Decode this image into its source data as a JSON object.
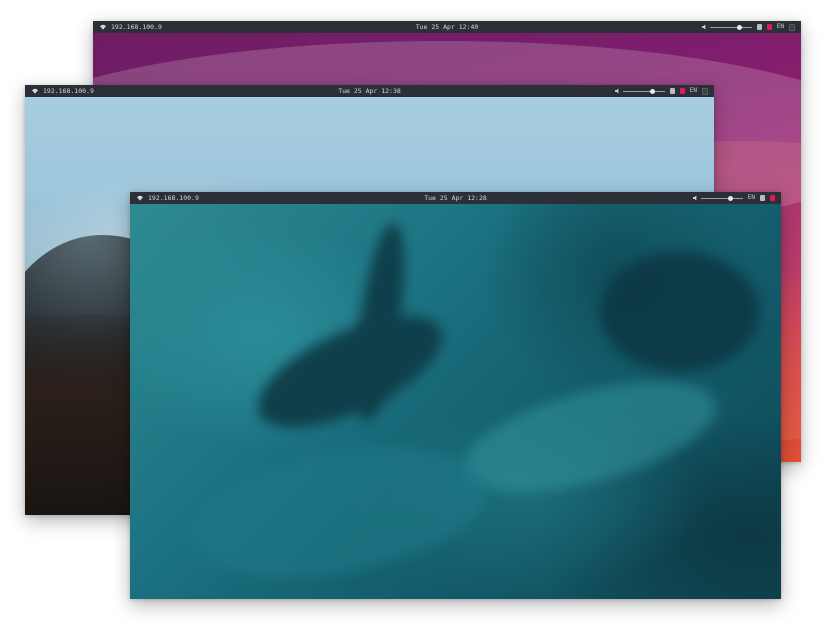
{
  "screens": {
    "back": {
      "ip": "192.168.100.9",
      "datetime": "Tue 25 Apr 12:40",
      "lang": "EN"
    },
    "mid": {
      "ip": "192.168.100.9",
      "datetime": "Tue 25 Apr 12:38",
      "lang": "EN"
    },
    "front": {
      "ip": "192.168.100.9",
      "datetime": "Tue 25 Apr 12:28",
      "lang": "EN"
    }
  },
  "volume": 0.7,
  "icons": {
    "network": "wifi-icon",
    "volume": "speaker-icon",
    "clipboard": "clipboard-icon",
    "app_tray": "app-tray-icon"
  },
  "colors": {
    "bar_bg": "#2b2f36",
    "bar_text": "#d6d9de",
    "tray_accent": "#e3176a"
  }
}
